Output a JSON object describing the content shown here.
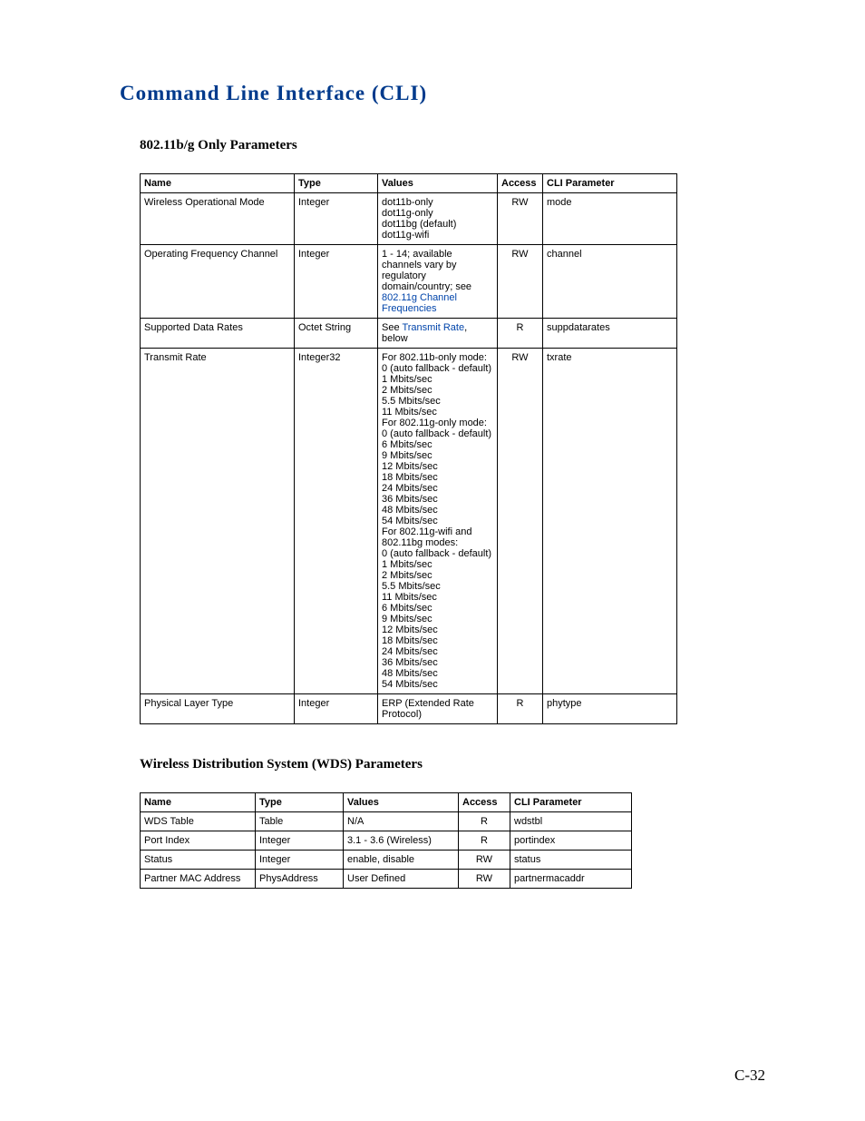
{
  "title": "Command Line Interface (CLI)",
  "section1": "802.11b/g Only Parameters",
  "t1": {
    "h": [
      "Name",
      "Type",
      "Values",
      "Access",
      "CLI Parameter"
    ],
    "rows": [
      {
        "name": "Wireless Operational Mode",
        "type": "Integer",
        "values_plain": "dot11b-only\ndot11g-only\ndot11bg (default)\ndot11g-wifi",
        "access": "RW",
        "cli": "mode"
      },
      {
        "name": "Operating Frequency Channel",
        "type": "Integer",
        "values_prefix": "1 - 14; available channels vary by regulatory domain/country; see ",
        "values_link": "802.11g Channel Frequencies",
        "access": "RW",
        "cli": "channel"
      },
      {
        "name": "Supported Data Rates",
        "type": "Octet String",
        "values_prefix": "See ",
        "values_link": "Transmit Rate",
        "values_suffix": ", below",
        "access": "R",
        "cli": "suppdatarates"
      },
      {
        "name": "Transmit Rate",
        "type": "Integer32",
        "values_plain": "For 802.11b-only mode:\n0 (auto fallback - default)\n1 Mbits/sec\n2 Mbits/sec\n5.5 Mbits/sec\n11 Mbits/sec\nFor 802.11g-only mode:\n0 (auto fallback - default)\n6 Mbits/sec\n9 Mbits/sec\n12 Mbits/sec\n18 Mbits/sec\n24 Mbits/sec\n36 Mbits/sec\n48 Mbits/sec\n54 Mbits/sec\nFor 802.11g-wifi and 802.11bg modes:\n0 (auto fallback - default)\n1 Mbits/sec\n2 Mbits/sec\n5.5 Mbits/sec\n11 Mbits/sec\n6 Mbits/sec\n9 Mbits/sec\n12 Mbits/sec\n18 Mbits/sec\n24 Mbits/sec\n36 Mbits/sec\n48 Mbits/sec\n54 Mbits/sec",
        "access": "RW",
        "cli": "txrate"
      },
      {
        "name": "Physical Layer Type",
        "type": "Integer",
        "values_plain": "ERP (Extended Rate Protocol)",
        "access": "R",
        "cli": "phytype"
      }
    ]
  },
  "section2": "Wireless Distribution System (WDS) Parameters",
  "t2": {
    "h": [
      "Name",
      "Type",
      "Values",
      "Access",
      "CLI Parameter"
    ],
    "rows": [
      {
        "name": "WDS Table",
        "type": "Table",
        "values": "N/A",
        "access": "R",
        "cli": "wdstbl"
      },
      {
        "name": "Port Index",
        "type": "Integer",
        "values": "3.1 - 3.6 (Wireless)",
        "access": "R",
        "cli": "portindex"
      },
      {
        "name": "Status",
        "type": "Integer",
        "values": "enable, disable",
        "access": "RW",
        "cli": "status"
      },
      {
        "name": "Partner MAC Address",
        "type": "PhysAddress",
        "values": "User Defined",
        "access": "RW",
        "cli": "partnermacaddr"
      }
    ]
  },
  "page_number": "C-32"
}
